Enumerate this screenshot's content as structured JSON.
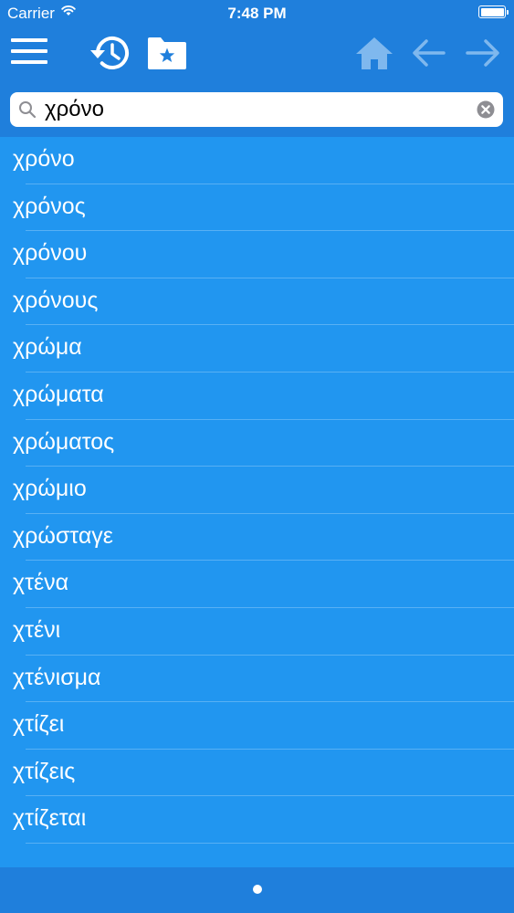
{
  "status_bar": {
    "carrier": "Carrier",
    "time": "7:48 PM"
  },
  "toolbar": {
    "menu_icon": "hamburger-icon",
    "history_icon": "history-icon",
    "bookmarks_icon": "bookmark-folder-icon",
    "home_icon": "home-icon",
    "back_icon": "arrow-left-icon",
    "forward_icon": "arrow-right-icon",
    "active_color": "#ffffff",
    "inactive_color": "#7fb8ee"
  },
  "search": {
    "value": "χρόνο",
    "search_icon": "search-icon",
    "clear_icon": "clear-icon"
  },
  "results": [
    {
      "label": "χρόνο"
    },
    {
      "label": "χρόνος"
    },
    {
      "label": "χρόνου"
    },
    {
      "label": "χρόνους"
    },
    {
      "label": "χρώμα"
    },
    {
      "label": "χρώματα"
    },
    {
      "label": "χρώματος"
    },
    {
      "label": "χρώμιο"
    },
    {
      "label": "χρώσταγε"
    },
    {
      "label": "χτένα"
    },
    {
      "label": "χτένι"
    },
    {
      "label": "χτένισμα"
    },
    {
      "label": "χτίζει"
    },
    {
      "label": "χτίζεις"
    },
    {
      "label": "χτίζεται"
    }
  ],
  "colors": {
    "header": "#1f7fdc",
    "list": "#2196f0",
    "text": "#ffffff"
  },
  "pager": {
    "pages": 1,
    "current": 1
  }
}
